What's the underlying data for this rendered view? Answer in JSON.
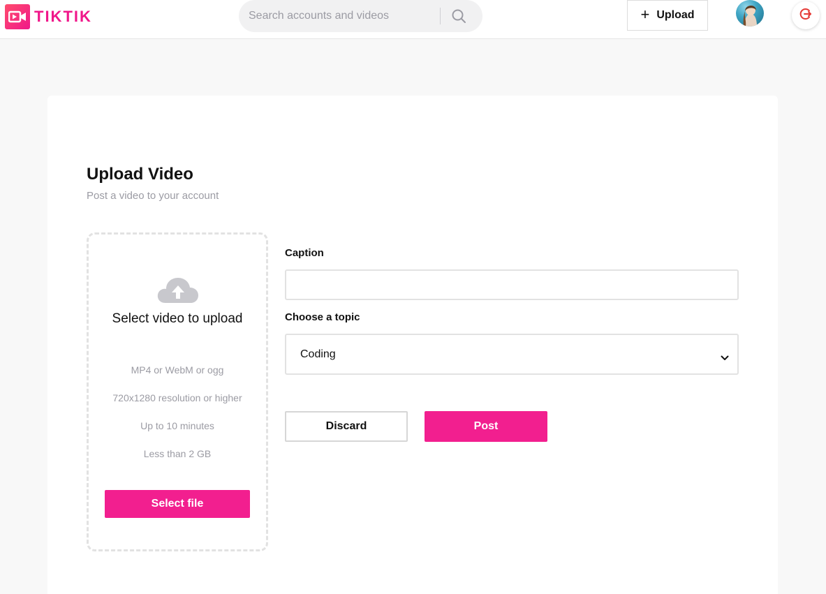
{
  "header": {
    "logo_text": "TIKTIK",
    "logo_icon": "video-camera-icon",
    "search": {
      "placeholder": "Search accounts and videos",
      "value": "",
      "icon": "search-icon"
    },
    "upload_button": {
      "label": "Upload",
      "icon": "plus-icon"
    },
    "avatar": "user-avatar",
    "logout_icon": "logout-icon"
  },
  "upload_card": {
    "title": "Upload Video",
    "subtitle": "Post a video to your account",
    "dropzone": {
      "icon": "cloud-upload-icon",
      "title": "Select video to upload",
      "specs": [
        "MP4 or WebM or ogg",
        "720x1280 resolution or higher",
        "Up to 10 minutes",
        "Less than 2 GB"
      ],
      "button_label": "Select file"
    },
    "caption": {
      "label": "Caption",
      "value": "",
      "placeholder": ""
    },
    "topic": {
      "label": "Choose a topic",
      "selected": "Coding"
    },
    "discard_label": "Discard",
    "post_label": "Post"
  },
  "colors": {
    "brand_pink": "#f21f8f",
    "logo_gradient_start": "#ff4d6d",
    "background": "#f8f8f8"
  }
}
